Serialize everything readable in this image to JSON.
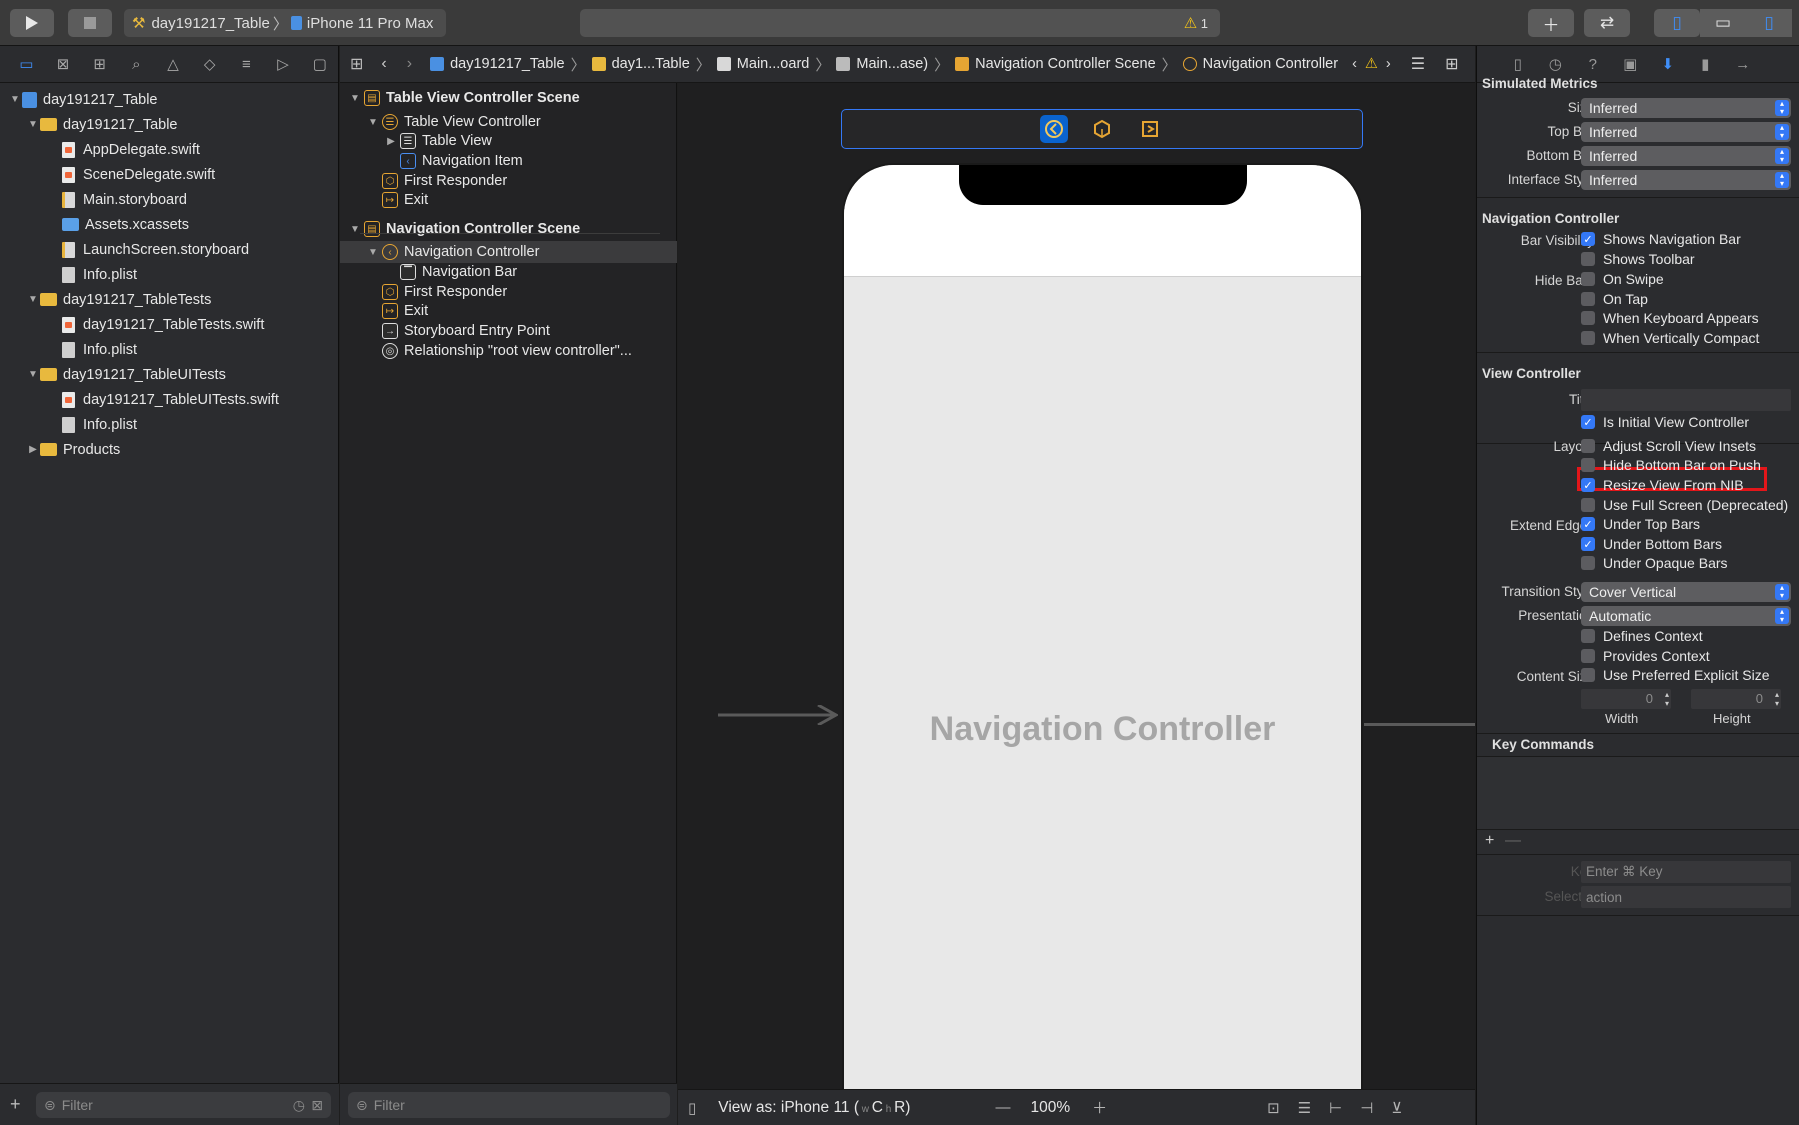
{
  "toolbar": {
    "scheme": "day191217_Table",
    "destination": "iPhone 11 Pro Max",
    "warning_count": "1"
  },
  "navigator": {
    "tree": [
      {
        "label": "day191217_Table",
        "indent": 0,
        "kind": "project",
        "expanded": true
      },
      {
        "label": "day191217_Table",
        "indent": 1,
        "kind": "folder",
        "expanded": true
      },
      {
        "label": "AppDelegate.swift",
        "indent": 2,
        "kind": "swift"
      },
      {
        "label": "SceneDelegate.swift",
        "indent": 2,
        "kind": "swift"
      },
      {
        "label": "Main.storyboard",
        "indent": 2,
        "kind": "storyboard"
      },
      {
        "label": "Assets.xcassets",
        "indent": 2,
        "kind": "assets"
      },
      {
        "label": "LaunchScreen.storyboard",
        "indent": 2,
        "kind": "storyboard"
      },
      {
        "label": "Info.plist",
        "indent": 2,
        "kind": "plist"
      },
      {
        "label": "day191217_TableTests",
        "indent": 1,
        "kind": "folder",
        "expanded": true
      },
      {
        "label": "day191217_TableTests.swift",
        "indent": 2,
        "kind": "swift"
      },
      {
        "label": "Info.plist",
        "indent": 2,
        "kind": "plist"
      },
      {
        "label": "day191217_TableUITests",
        "indent": 1,
        "kind": "folder",
        "expanded": true
      },
      {
        "label": "day191217_TableUITests.swift",
        "indent": 2,
        "kind": "swift"
      },
      {
        "label": "Info.plist",
        "indent": 2,
        "kind": "plist"
      },
      {
        "label": "Products",
        "indent": 1,
        "kind": "folder",
        "expanded": false
      }
    ],
    "filter_placeholder": "Filter"
  },
  "jumpbar": {
    "crumbs": [
      "day191217_Table",
      "day1...Table",
      "Main...oard",
      "Main...ase)",
      "Navigation Controller Scene",
      "Navigation Controller"
    ]
  },
  "outline": {
    "items": [
      {
        "label": "Table View Controller Scene",
        "level": 0,
        "bold": true,
        "disc": "▼",
        "icon": "scene"
      },
      {
        "label": "Table View Controller",
        "level": 1,
        "disc": "▼",
        "icon": "vc"
      },
      {
        "label": "Table View",
        "level": 2,
        "disc": "▶",
        "icon": "tableview"
      },
      {
        "label": "Navigation Item",
        "level": 2,
        "disc": "",
        "icon": "navitem"
      },
      {
        "label": "First Responder",
        "level": 1,
        "disc": "",
        "icon": "responder"
      },
      {
        "label": "Exit",
        "level": 1,
        "disc": "",
        "icon": "exit"
      },
      {
        "label": "Navigation Controller Scene",
        "level": 0,
        "bold": true,
        "disc": "▼",
        "icon": "scene"
      },
      {
        "label": "Navigation Controller",
        "level": 1,
        "disc": "▼",
        "icon": "navcontroller",
        "selected": true
      },
      {
        "label": "Navigation Bar",
        "level": 2,
        "disc": "",
        "icon": "navbar"
      },
      {
        "label": "First Responder",
        "level": 1,
        "disc": "",
        "icon": "responder"
      },
      {
        "label": "Exit",
        "level": 1,
        "disc": "",
        "icon": "exit"
      },
      {
        "label": "Storyboard Entry Point",
        "level": 1,
        "disc": "",
        "icon": "arrow"
      },
      {
        "label": "Relationship \"root view controller\"...",
        "level": 1,
        "disc": "",
        "icon": "relationship"
      }
    ],
    "filter_placeholder": "Filter"
  },
  "canvas": {
    "device_label": "Navigation Controller",
    "view_as": "View as: iPhone 11 (",
    "view_as_c": "C",
    "view_as_r": "R)",
    "zoom": "100%"
  },
  "inspector": {
    "simulated_metrics": {
      "title": "Simulated Metrics",
      "rows": [
        {
          "label": "Size",
          "value": "Inferred"
        },
        {
          "label": "Top Bar",
          "value": "Inferred"
        },
        {
          "label": "Bottom Bar",
          "value": "Inferred"
        },
        {
          "label": "Interface Style",
          "value": "Inferred"
        }
      ]
    },
    "navigation_controller": {
      "title": "Navigation Controller",
      "bar_visibility_label": "Bar Visibility",
      "hide_bars_label": "Hide Bars",
      "checks": [
        {
          "label": "Shows Navigation Bar",
          "checked": true
        },
        {
          "label": "Shows Toolbar",
          "checked": false
        },
        {
          "label": "On Swipe",
          "checked": false
        },
        {
          "label": "On Tap",
          "checked": false
        },
        {
          "label": "When Keyboard Appears",
          "checked": false
        },
        {
          "label": "When Vertically Compact",
          "checked": false
        }
      ]
    },
    "view_controller": {
      "title": "View Controller",
      "title_label": "Title",
      "title_value": "",
      "initial": {
        "label": "Is Initial View Controller",
        "checked": true
      },
      "layout_label": "Layout",
      "layout_checks": [
        {
          "label": "Adjust Scroll View Insets",
          "checked": false
        },
        {
          "label": "Hide Bottom Bar on Push",
          "checked": false
        },
        {
          "label": "Resize View From NIB",
          "checked": true
        },
        {
          "label": "Use Full Screen (Deprecated)",
          "checked": false
        }
      ],
      "extend_edges_label": "Extend Edges",
      "edge_checks": [
        {
          "label": "Under Top Bars",
          "checked": true
        },
        {
          "label": "Under Bottom Bars",
          "checked": true
        },
        {
          "label": "Under Opaque Bars",
          "checked": false
        }
      ],
      "transition_style_label": "Transition Style",
      "transition_style": "Cover Vertical",
      "presentation_label": "Presentation",
      "presentation": "Automatic",
      "context_checks": [
        {
          "label": "Defines Context",
          "checked": false
        },
        {
          "label": "Provides Context",
          "checked": false
        }
      ],
      "content_size_label": "Content Size",
      "content_size_check": {
        "label": "Use Preferred Explicit Size",
        "checked": false
      },
      "width_value": "0",
      "height_value": "0",
      "width_label": "Width",
      "height_label": "Height"
    },
    "key_commands": {
      "title": "Key Commands",
      "key_label": "Key",
      "key_placeholder": "Enter ⌘ Key",
      "selector_label": "Selector",
      "selector_placeholder": "action"
    }
  },
  "colors": {
    "accent": "#3478f6",
    "highlight": "#e3161a"
  }
}
